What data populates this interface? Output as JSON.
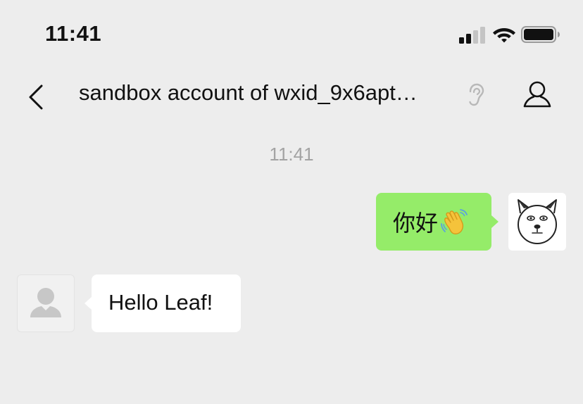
{
  "status_bar": {
    "time": "11:41",
    "icons": [
      "cellular-signal-icon",
      "wifi-icon",
      "battery-icon"
    ]
  },
  "nav": {
    "back_icon": "chevron-left-icon",
    "title": "sandbox account of wxid_9x6apt…",
    "title_icon": "ear-icon",
    "profile_icon": "person-icon"
  },
  "chat": {
    "time_divider": "11:41",
    "messages": [
      {
        "direction": "outgoing",
        "text": "你好",
        "emoji": "waving-hand-emoji",
        "avatar": "cartoon-cat-face-avatar"
      },
      {
        "direction": "incoming",
        "text": "Hello Leaf!",
        "avatar": "default-person-avatar"
      }
    ]
  },
  "colors": {
    "background": "#ededed",
    "outgoing_bubble": "#95ec69",
    "incoming_bubble": "#ffffff",
    "timestamp_text": "#a3a3a3"
  }
}
